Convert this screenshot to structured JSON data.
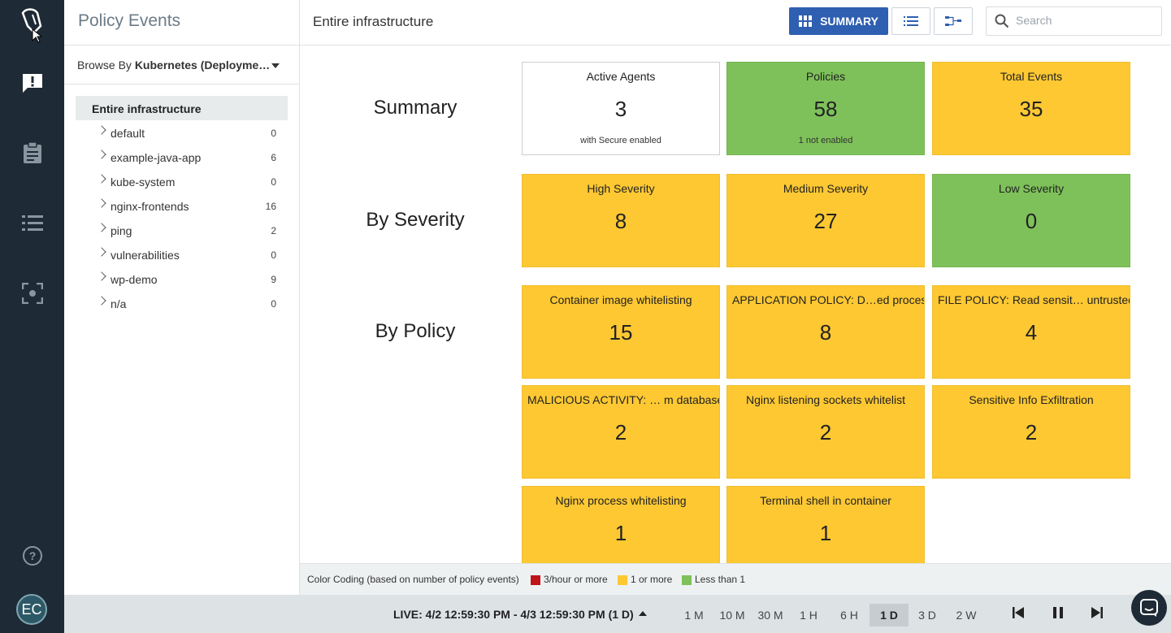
{
  "rail": {
    "avatar_initials": "EC",
    "items": [
      "logo-icon",
      "alert-icon",
      "clipboard-icon",
      "list-icon",
      "scan-icon",
      "help-icon"
    ]
  },
  "panel": {
    "title": "Policy Events",
    "browse_prefix": "Browse By",
    "browse_value": "Kubernetes (Deployme…",
    "root": "Entire infrastructure",
    "items": [
      {
        "name": "default",
        "count": "0"
      },
      {
        "name": "example-java-app",
        "count": "6"
      },
      {
        "name": "kube-system",
        "count": "0"
      },
      {
        "name": "nginx-frontends",
        "count": "16"
      },
      {
        "name": "ping",
        "count": "2"
      },
      {
        "name": "vulnerabilities",
        "count": "0"
      },
      {
        "name": "wp-demo",
        "count": "9"
      },
      {
        "name": "n/a",
        "count": "0"
      }
    ]
  },
  "topbar": {
    "title": "Entire infrastructure",
    "summary_label": "SUMMARY",
    "search_placeholder": "Search"
  },
  "sections": {
    "summary": "Summary",
    "severity": "By Severity",
    "policy": "By Policy"
  },
  "summary_tiles": [
    {
      "label": "Active Agents",
      "value": "3",
      "sub": "with Secure enabled",
      "color": "#ffffff"
    },
    {
      "label": "Policies",
      "value": "58",
      "sub": "1 not enabled",
      "color": "#7ec15a"
    },
    {
      "label": "Total Events",
      "value": "35",
      "sub": "",
      "color": "#fdc832"
    }
  ],
  "severity_tiles": [
    {
      "label": "High Severity",
      "value": "8",
      "color": "#fdc832"
    },
    {
      "label": "Medium Severity",
      "value": "27",
      "color": "#fdc832"
    },
    {
      "label": "Low Severity",
      "value": "0",
      "color": "#7ec15a"
    }
  ],
  "policy_tiles": [
    {
      "label": "Container image whitelisting",
      "value": "15"
    },
    {
      "label": "APPLICATION POLICY: D…ed process",
      "value": "8"
    },
    {
      "label": "FILE POLICY: Read sensit… untrusted",
      "value": "4"
    },
    {
      "label": "MALICIOUS ACTIVITY: … m database",
      "value": "2"
    },
    {
      "label": "Nginx listening sockets whitelist",
      "value": "2"
    },
    {
      "label": "Sensitive Info Exfiltration",
      "value": "2"
    },
    {
      "label": "Nginx process whitelisting",
      "value": "1"
    },
    {
      "label": "Terminal shell in container",
      "value": "1"
    }
  ],
  "legend": {
    "title": "Color Coding (based on number of policy events)",
    "items": [
      {
        "label": "3/hour or more",
        "color": "#c0141a"
      },
      {
        "label": "1 or more",
        "color": "#fdc832"
      },
      {
        "label": "Less than 1",
        "color": "#7ec15a"
      }
    ]
  },
  "timebar": {
    "live_label": "LIVE: 4/2 12:59:30 PM - 4/3 12:59:30 PM (1 D)",
    "ranges": [
      "1 M",
      "10 M",
      "30 M",
      "1 H",
      "6 H",
      "1 D",
      "3 D",
      "2 W"
    ],
    "active_range": "1 D"
  }
}
